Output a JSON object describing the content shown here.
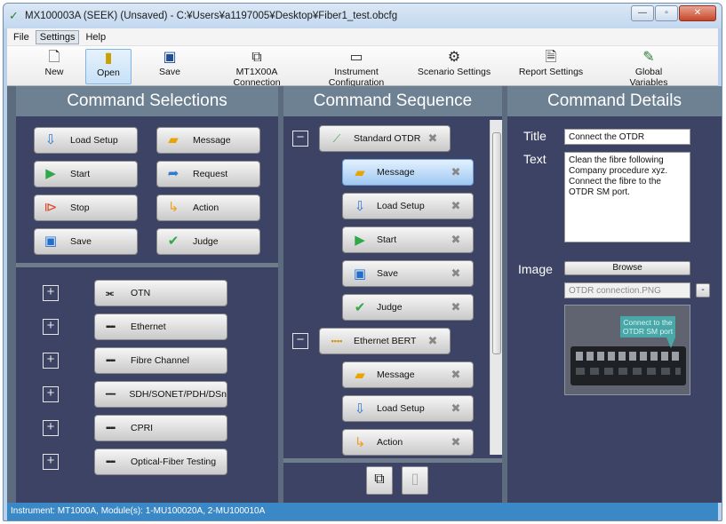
{
  "window": {
    "title": "MX100003A (SEEK) (Unsaved) - C:¥Users¥a1197005¥Desktop¥Fiber1_test.obcfg"
  },
  "menu": [
    "File",
    "Settings",
    "Help"
  ],
  "toolbar": {
    "new": "New",
    "open": "Open",
    "save": "Save",
    "mt1x00a": "MT1X00A Connection",
    "instrument": "Instrument Configuration",
    "scenario": "Scenario Settings",
    "report": "Report Settings",
    "global": "Global Variables"
  },
  "headers": {
    "selections": "Command Selections",
    "sequence": "Command Sequence",
    "details": "Command Details"
  },
  "commands": {
    "load_setup": "Load Setup",
    "message": "Message",
    "start": "Start",
    "request": "Request",
    "stop": "Stop",
    "action": "Action",
    "save": "Save",
    "judge": "Judge"
  },
  "categories": [
    "OTN",
    "Ethernet",
    "Fibre Channel",
    "SDH/SONET/PDH/DSn",
    "CPRI",
    "Optical-Fiber Testing"
  ],
  "sequence": {
    "group1": "Standard OTDR",
    "group1_items": [
      "Message",
      "Load Setup",
      "Start",
      "Save",
      "Judge"
    ],
    "group2": "Ethernet BERT",
    "group2_items": [
      "Message",
      "Load Setup",
      "Action"
    ]
  },
  "details": {
    "title_label": "Title",
    "title_value": "Connect the OTDR",
    "text_label": "Text",
    "text_value": "Clean the fibre following Company procedure xyz. Connect the fibre to the OTDR SM port.",
    "image_label": "Image",
    "browse": "Browse",
    "image_file": "OTDR connection.PNG",
    "remove": "-",
    "image_callout": "Connect to the OTDR SM port"
  },
  "status": "Instrument: MT1000A, Module(s): 1-MU100020A, 2-MU100010A",
  "colors": {
    "panel_bg": "#3d4364",
    "header_bg": "#6e8193",
    "status_bg": "#3b88c7",
    "selected_item": "#9fc8f2"
  }
}
